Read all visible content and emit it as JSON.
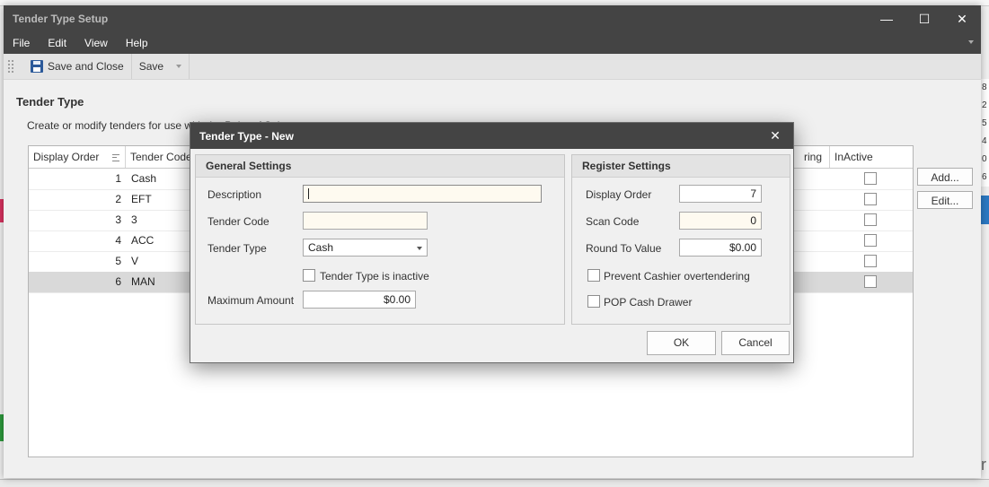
{
  "window": {
    "title": "Tender Type Setup",
    "minimize_icon": "minimize-icon",
    "maximize_icon": "maximize-icon",
    "close_icon": "close-icon"
  },
  "menu": [
    "File",
    "Edit",
    "View",
    "Help"
  ],
  "toolbar": {
    "save_close_label": "Save and Close",
    "save_label": "Save"
  },
  "section": {
    "title": "Tender Type",
    "description": "Create or modify tenders for use with the Point of Sale"
  },
  "grid": {
    "columns": {
      "display_order": "Display Order",
      "tender_code": "Tender Code",
      "ring_fragment": "ring",
      "inactive": "InActive"
    },
    "rows": [
      {
        "order": "1",
        "code": "Cash"
      },
      {
        "order": "2",
        "code": "EFT"
      },
      {
        "order": "3",
        "code": "3"
      },
      {
        "order": "4",
        "code": "ACC"
      },
      {
        "order": "5",
        "code": "V"
      },
      {
        "order": "6",
        "code": "MAN"
      }
    ],
    "selected_row": 5
  },
  "side_buttons": {
    "add": "Add...",
    "edit": "Edit..."
  },
  "background": {
    "right_digits": [
      "8",
      "2",
      "5",
      "4",
      "0",
      "6"
    ],
    "glyph": "r"
  },
  "dialog": {
    "title": "Tender Type - New",
    "general": {
      "heading": "General Settings",
      "description_label": "Description",
      "description_value": "",
      "tender_code_label": "Tender Code",
      "tender_code_value": "",
      "tender_type_label": "Tender Type",
      "tender_type_value": "Cash",
      "inactive_label": "Tender Type is inactive",
      "max_amount_label": "Maximum Amount",
      "max_amount_value": "$0.00"
    },
    "register": {
      "heading": "Register Settings",
      "display_order_label": "Display Order",
      "display_order_value": "7",
      "scan_code_label": "Scan Code",
      "scan_code_value": "0",
      "round_label": "Round To Value",
      "round_value": "$0.00",
      "prevent_label": "Prevent Cashier overtendering",
      "pop_label": "POP Cash Drawer"
    },
    "ok_label": "OK",
    "cancel_label": "Cancel"
  },
  "colors": {
    "titlebar": "#444444",
    "selected_row": "#d9d9d9",
    "required_field": "#fefaf0"
  }
}
